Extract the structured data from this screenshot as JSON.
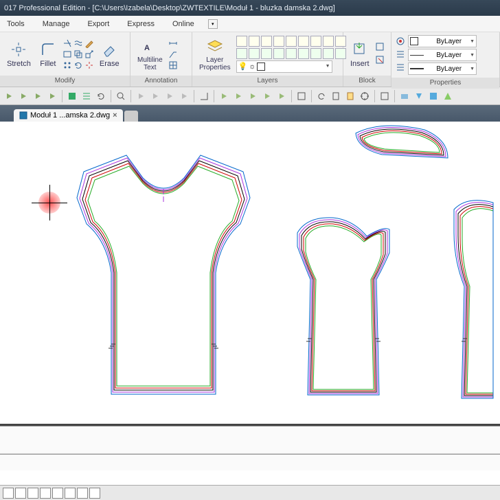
{
  "title": "017 Professional Edition - [C:\\Users\\Izabela\\Desktop\\ZWTEXTILE\\Moduł 1 - bluzka damska 2.dwg]",
  "menu": {
    "tools": "Tools",
    "manage": "Manage",
    "export": "Export",
    "express": "Express",
    "online": "Online"
  },
  "ribbon": {
    "modify": {
      "stretch": "Stretch",
      "fillet": "Fillet",
      "erase": "Erase",
      "label": "Modify"
    },
    "annotation": {
      "mtext": "Multiline\nText",
      "label": "Annotation"
    },
    "layers": {
      "lprops": "Layer\nProperties",
      "label": "Layers"
    },
    "block": {
      "insert": "Insert",
      "label": "Block"
    },
    "properties": {
      "bylayer": "ByLayer",
      "label": "Properties"
    }
  },
  "tab": {
    "name": "Moduł 1 ...amska 2.dwg"
  }
}
